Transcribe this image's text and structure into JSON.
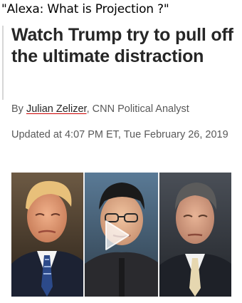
{
  "caption": "\"Alexa: What is Projection ?\"",
  "article": {
    "headline": "Watch Trump try to pull off the ultimate distraction",
    "byline_prefix": "By ",
    "author": "Julian Zelizer",
    "author_role": ", CNN Political Analyst",
    "timestamp": "Updated at 4:07 PM ET, Tue February 26, 2019"
  },
  "video": {
    "panels": [
      "trump-portrait",
      "kim-portrait",
      "cohen-portrait"
    ],
    "play_icon": "play-icon"
  },
  "colors": {
    "headline": "#262626",
    "meta": "#595959",
    "author_underline": "#cc0000"
  }
}
